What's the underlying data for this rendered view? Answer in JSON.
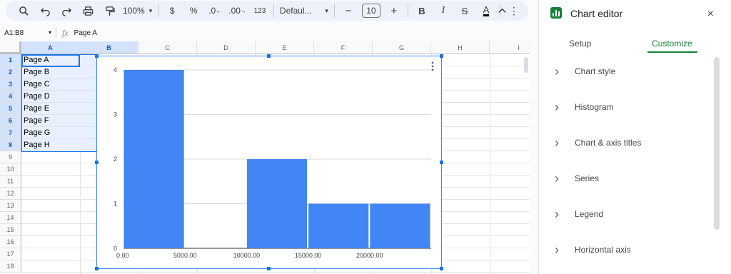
{
  "toolbar": {
    "zoom": "100%",
    "currency": "$",
    "percent": "%",
    "decrease_decimal": ".0",
    "increase_decimal": ".00",
    "number_format": "123",
    "font": "Defaul...",
    "font_size": "10",
    "bold": "B",
    "italic": "I",
    "strike": "S",
    "text_color": "A"
  },
  "formula_bar": {
    "name_box": "A1:B8",
    "fx": "fx",
    "content": "Page A"
  },
  "grid": {
    "columns": [
      "A",
      "B",
      "C",
      "D",
      "E",
      "F",
      "G",
      "H",
      "I"
    ],
    "rows": [
      "1",
      "2",
      "3",
      "4",
      "5",
      "6",
      "7",
      "8",
      "9",
      "10",
      "11",
      "12",
      "13",
      "14",
      "15",
      "16",
      "17",
      "18"
    ],
    "cells_a": [
      "Page A",
      "Page B",
      "Page C",
      "Page D",
      "Page E",
      "Page F",
      "Page G",
      "Page H"
    ]
  },
  "chart_data": {
    "type": "bar",
    "bins": [
      {
        "x0": 0,
        "x1": 5000,
        "value": 4
      },
      {
        "x0": 5000,
        "x1": 10000,
        "value": 0
      },
      {
        "x0": 10000,
        "x1": 15000,
        "value": 2
      },
      {
        "x0": 15000,
        "x1": 20000,
        "value": 1
      },
      {
        "x0": 20000,
        "x1": 25000,
        "value": 1
      }
    ],
    "x_ticks": [
      "0.00",
      "5000.00",
      "10000.00",
      "15000.00",
      "20000.00"
    ],
    "y_ticks": [
      "0",
      "1",
      "2",
      "3",
      "4"
    ],
    "ylim": [
      0,
      4
    ],
    "xlim": [
      0,
      25000
    ],
    "grid": true,
    "color": "#4285f4"
  },
  "panel": {
    "title": "Chart editor",
    "close": "×",
    "tabs": [
      "Setup",
      "Customize"
    ],
    "active_tab": "Customize",
    "sections": [
      "Chart style",
      "Histogram",
      "Chart & axis titles",
      "Series",
      "Legend",
      "Horizontal axis"
    ]
  },
  "colors": {
    "accent": "#1a73e8",
    "green": "#188038",
    "bar": "#4285f4"
  }
}
